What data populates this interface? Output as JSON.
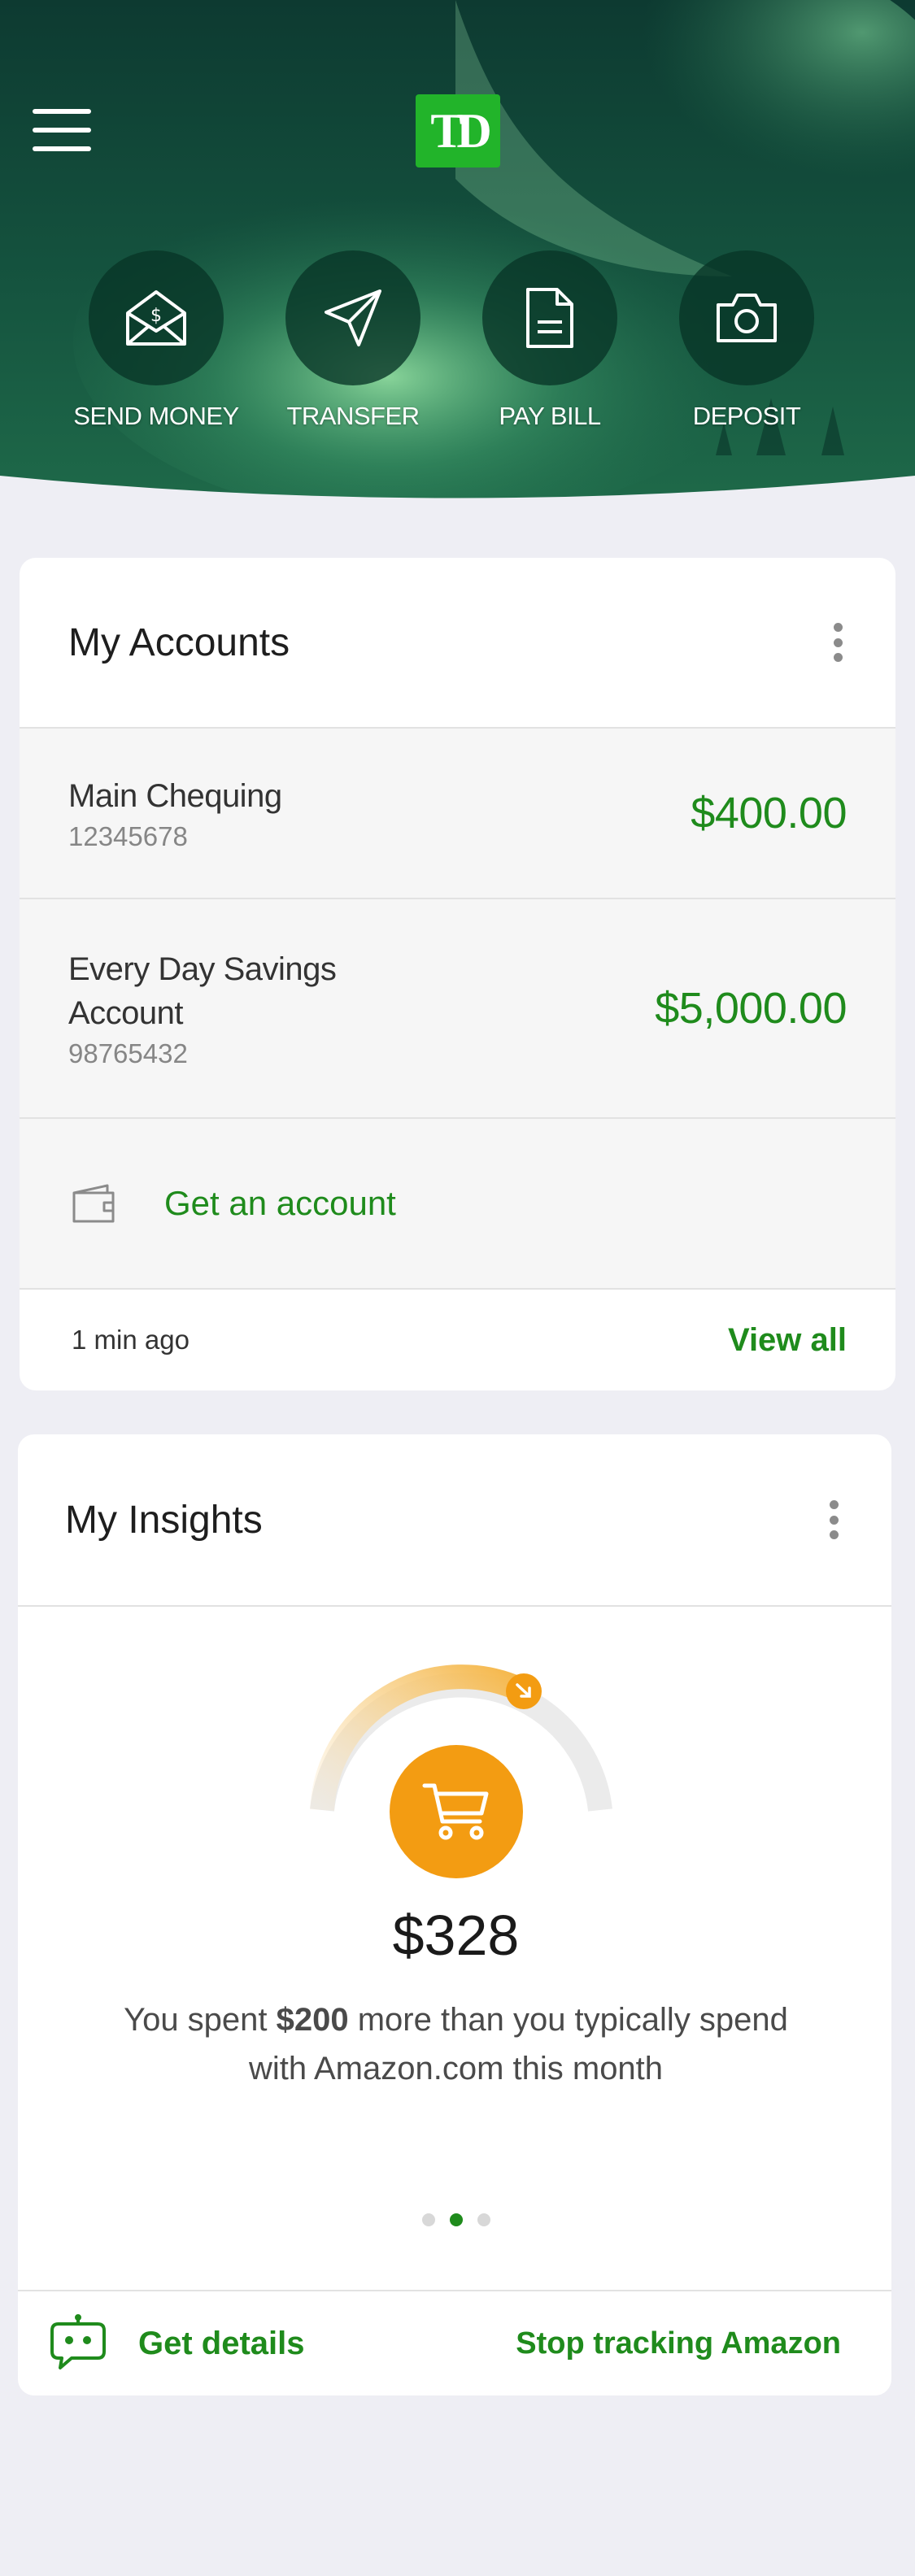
{
  "header": {
    "logo_text": "TD",
    "actions": [
      {
        "label": "SEND MONEY",
        "icon": "envelope-dollar-icon"
      },
      {
        "label": "TRANSFER",
        "icon": "paper-plane-icon"
      },
      {
        "label": "PAY BILL",
        "icon": "document-icon"
      },
      {
        "label": "DEPOSIT",
        "icon": "camera-icon"
      }
    ]
  },
  "accounts": {
    "title": "My Accounts",
    "items": [
      {
        "name": "Main Chequing",
        "number": "12345678",
        "balance": "$400.00"
      },
      {
        "name": "Every Day Savings Account",
        "number": "98765432",
        "balance": "$5,000.00"
      }
    ],
    "get_account_label": "Get an account",
    "updated": "1 min ago",
    "view_all": "View all"
  },
  "insights": {
    "title": "My Insights",
    "amount": "$328",
    "text_pre": "You spent ",
    "text_bold": "$200",
    "text_post": " more than you typically spend with Amazon.com this month",
    "page_count": 3,
    "active_page": 2,
    "get_details": "Get details",
    "stop_tracking": "Stop tracking Amazon"
  },
  "colors": {
    "brand_green": "#22b42a",
    "link_green": "#1f8b1c",
    "insight_orange": "#f39c12",
    "page_bg": "#eeeef4"
  }
}
